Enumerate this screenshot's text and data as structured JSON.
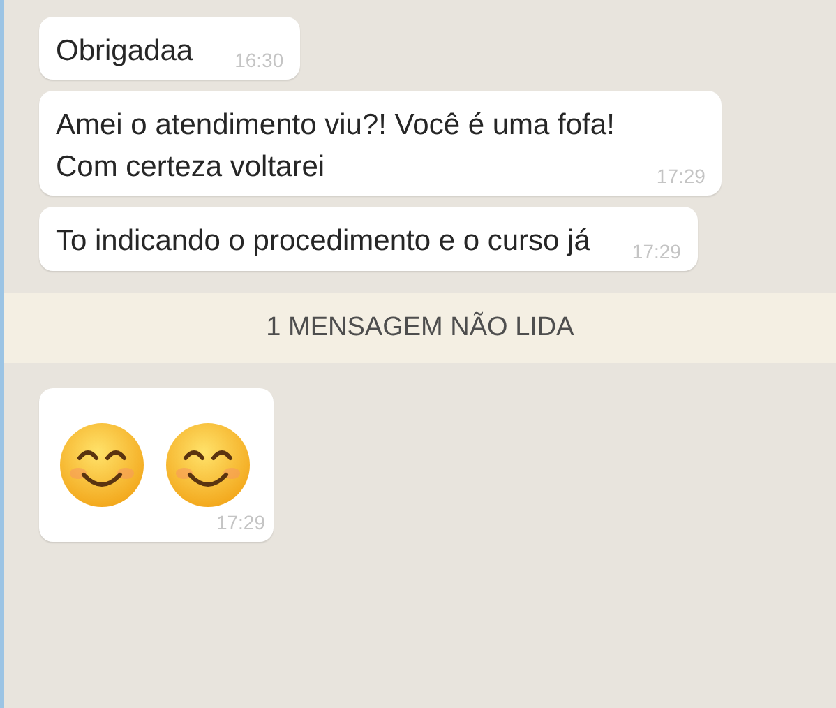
{
  "messages": [
    {
      "kind": "text",
      "text": "Obrigadaa",
      "time": "16:30"
    },
    {
      "kind": "text",
      "text": "Amei o atendimento viu?! Você é uma fofa!\nCom certeza voltarei",
      "time": "17:29"
    },
    {
      "kind": "text",
      "text": "To indicando o procedimento e o curso já",
      "time": "17:29"
    },
    {
      "kind": "divider",
      "text": "1 MENSAGEM NÃO LIDA"
    },
    {
      "kind": "emoji",
      "icons": [
        {
          "kind": "smiling-face"
        },
        {
          "kind": "smiling-face"
        }
      ],
      "time": "17:29"
    }
  ]
}
